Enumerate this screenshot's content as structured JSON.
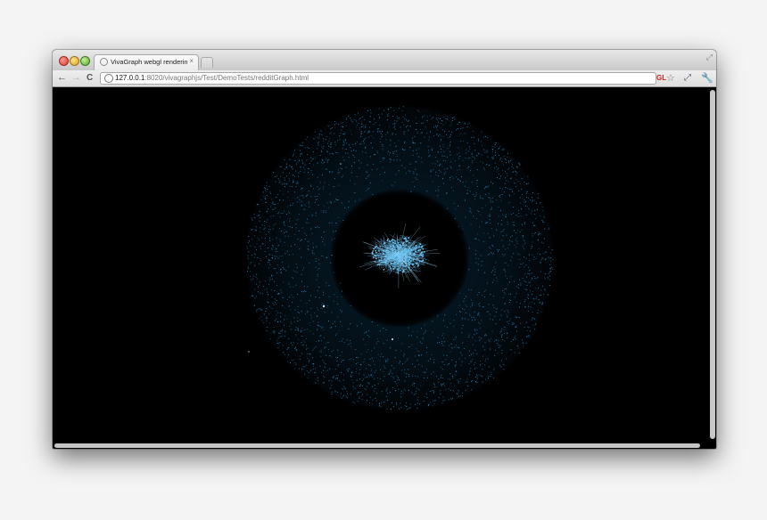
{
  "browser": {
    "tab_title": "VivaGraph webgl rendering",
    "tab_close": "×",
    "url_host": "127.0.0.1",
    "url_rest": ":8020/vivagraphjs/Test/DemoTests/redditGraph.html",
    "gl_badge": "GL",
    "icons": {
      "back": "←",
      "forward": "→",
      "reload": "C",
      "star": "☆",
      "extension": "⤢",
      "wrench": "🔧"
    }
  },
  "graph_view": {
    "background_color": "#000000",
    "node_color": "#3a9ad8",
    "cluster_color": "#6cc3f3"
  }
}
